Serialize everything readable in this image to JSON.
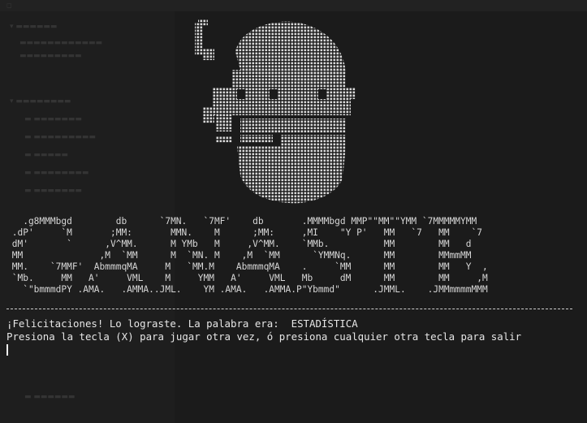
{
  "terminal": {
    "banner_lines": [
      "   .g8MMMbgd        db      `7MN.   `7MF'    db       .MMMMbgd MMP\"\"MM\"\"YMM `7MMMMMYMM",
      " .dP'     `M       ;MM:       MMN.    M      ;MM:     ,MI    \"Y P'   MM   `7   MM    `7",
      " dM'       `      ,V^MM.      M YMb   M     ,V^MM.    `MMb.          MM        MM   d",
      " MM              ,M  `MM      M  `MN. M    ,M  `MM      `YMMNq.      MM        MMmmMM",
      " MM.    `7MMF'  AbmmmqMA     M   `MM.M    AbmmmqMA    .     `MM      MM        MM   Y  ,",
      " `Mb.     MM   A'     VML    M     YMM   A'     VML   Mb     dM      MM        MM     ,M",
      "   `\"bmmmdPY .AMA.   .AMMA..JML.    YM .AMA.   .AMMA.P\"Ybmmd\"      .JMML.    .JMMmmmmMMM"
    ],
    "message": "¡Felicitaciones! Lo lograste. La palabra era:  ESTADÍSTICA",
    "prompt": "Presiona la tecla (X) para jugar otra vez, ó presiona cualquier otra tecla para salir"
  },
  "colors": {
    "background": "#1b1b1b",
    "text": "#e6e6e6",
    "art": "#d8d8d8"
  }
}
